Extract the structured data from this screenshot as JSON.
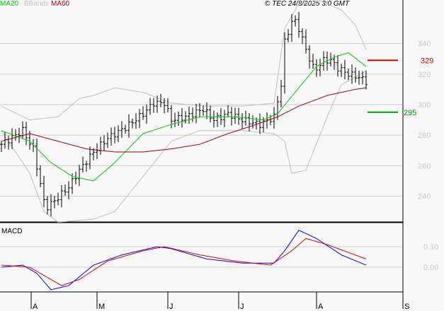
{
  "chart_data": {
    "type": "line",
    "title": "",
    "copyright": "© TEC 24/8/2025 3:0 GMT",
    "legend": [
      {
        "name": "MA20",
        "color": "#00cc00"
      },
      {
        "name": "BBands",
        "color": "#c0c0c0"
      },
      {
        "name": "MA60",
        "color": "#aa0000"
      }
    ],
    "price_axis": {
      "ylim": [
        225,
        373
      ],
      "ticks": [
        "340",
        "320",
        "300",
        "280",
        "260",
        "240"
      ],
      "tick_values": [
        340,
        320,
        300,
        280,
        260,
        240
      ]
    },
    "x_axis": {
      "xlim": [
        0,
        114
      ],
      "ticks": [
        "A",
        "M",
        "J",
        "J",
        "A",
        "S"
      ],
      "tick_positions": [
        8.4,
        27,
        47,
        67,
        89,
        113.4
      ]
    },
    "levels": [
      {
        "label": "329",
        "value": 329,
        "color": "#cc0000"
      },
      {
        "label": "295",
        "value": 295,
        "color": "#009900"
      }
    ],
    "price_keypoints": {
      "x": [
        0,
        6,
        9,
        11,
        12.4,
        15,
        19,
        22,
        26,
        30,
        35,
        40,
        43,
        46,
        48,
        52,
        57,
        60,
        64,
        68,
        73,
        77,
        79,
        80,
        82.4,
        84,
        86,
        88.4,
        91,
        93,
        95,
        98,
        101,
        103
      ],
      "close": [
        274,
        283,
        271,
        248,
        232,
        237,
        246,
        257,
        269,
        278,
        285,
        294,
        301,
        301,
        290,
        292,
        297,
        290,
        294,
        290,
        287,
        292,
        313,
        341,
        357,
        350,
        336,
        322,
        329,
        329,
        324,
        320,
        318,
        315
      ]
    },
    "ma20": {
      "x": [
        0,
        8,
        14,
        20,
        26,
        32,
        40,
        48,
        56,
        66,
        74,
        78,
        84,
        89,
        94,
        98,
        103
      ],
      "y": [
        283,
        276,
        262,
        253,
        250,
        262,
        281,
        287,
        292,
        292,
        290,
        294,
        311,
        325,
        331,
        334,
        325
      ]
    },
    "ma60": {
      "x": [
        0,
        8,
        16,
        24,
        32,
        40,
        48,
        56,
        64,
        72,
        78,
        84,
        92,
        100,
        103
      ],
      "y": [
        276,
        281,
        276,
        271,
        269,
        269,
        271,
        274,
        281,
        287,
        292,
        299,
        306,
        310,
        311
      ]
    },
    "bb_upper": {
      "x": [
        0,
        8,
        16,
        22,
        26,
        32,
        40,
        48,
        58,
        68,
        77,
        80,
        84,
        90,
        96,
        100,
        103
      ],
      "y": [
        299,
        290,
        292,
        304,
        306,
        311,
        308,
        301,
        299,
        299,
        301,
        350,
        366,
        368,
        362,
        352,
        336
      ]
    },
    "bb_lower": {
      "x": [
        0,
        8,
        12,
        16,
        26,
        32,
        40,
        48,
        56,
        68,
        77,
        80,
        82,
        86,
        92,
        96,
        100,
        103
      ],
      "y": [
        283,
        255,
        230,
        223,
        225,
        230,
        253,
        276,
        283,
        283,
        281,
        276,
        255,
        257,
        292,
        313,
        318,
        322
      ]
    },
    "macd": {
      "label": "MACD",
      "ylim": [
        -0.12,
        0.22
      ],
      "ticks": [
        "0.10",
        "0.00"
      ],
      "tick_values": [
        0.1,
        0
      ],
      "line": {
        "x": [
          0,
          6,
          10,
          14,
          19,
          26,
          34,
          44,
          48,
          58,
          68,
          77,
          80,
          84,
          89,
          96,
          103
        ],
        "y": [
          0,
          0.01,
          -0.03,
          -0.11,
          -0.09,
          0.01,
          0.06,
          0.1,
          0.09,
          0.04,
          0.02,
          0.02,
          0.08,
          0.18,
          0.14,
          0.06,
          0.01
        ]
      },
      "signal": {
        "x": [
          0,
          8,
          12,
          17,
          22,
          30,
          40,
          46,
          56,
          66,
          76,
          82,
          86,
          92,
          103
        ],
        "y": [
          0.01,
          0,
          -0.04,
          -0.09,
          -0.06,
          0.03,
          0.08,
          0.1,
          0.06,
          0.03,
          0.01,
          0.08,
          0.14,
          0.11,
          0.04
        ]
      }
    }
  }
}
